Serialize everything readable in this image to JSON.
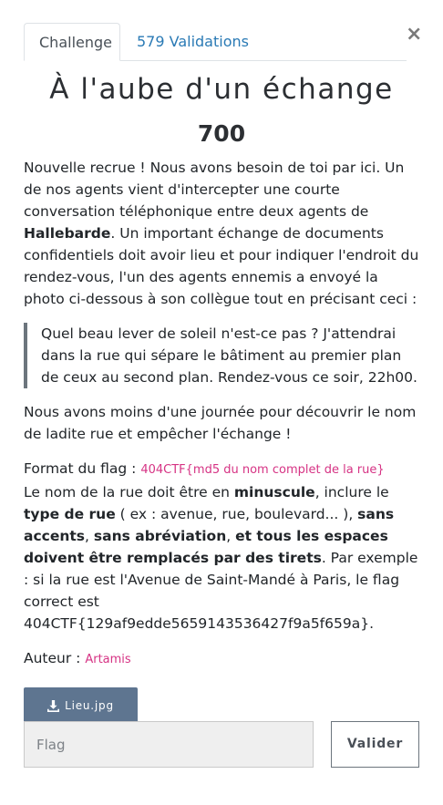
{
  "tabs": {
    "challenge": "Challenge",
    "validations": "579 Validations"
  },
  "close_glyph": "×",
  "challenge": {
    "title": "À l'aube d'un échange",
    "points": "700",
    "intro_1": "Nouvelle recrue ! Nous avons besoin de toi par ici. Un de nos agents vient d'intercepter une courte conversation téléphonique entre deux agents de ",
    "intro_bold": "Hallebarde",
    "intro_2": ". Un important échange de documents confidentiels doit avoir lieu et pour indiquer l'endroit du rendez-vous, l'un des agents ennemis a envoyé la photo ci-dessous à son collègue tout en précisant ceci :",
    "quote": "Quel beau lever de soleil n'est-ce pas ? J'attendrai dans la rue qui sépare le bâtiment au premier plan de ceux au second plan. Rendez-vous ce soir, 22h00.",
    "goal": "Nous avons moins d'une journée pour découvrir le nom de ladite rue et empêcher l'échange !",
    "format_label": "Format du flag : ",
    "format_value": "404CTF{md5 du nom complet de la rue}",
    "rule_1": "Le nom de la rue doit être en ",
    "rule_minuscule": "minuscule",
    "rule_2": ", inclure le ",
    "rule_type": "type de rue",
    "rule_3": " ( ex : avenue, rue, boulevard... ), ",
    "rule_accents": "sans accents",
    "rule_4": ", ",
    "rule_abbr": "sans abréviation",
    "rule_5": ", ",
    "rule_spaces": "et tous les espaces doivent être remplacés par des tirets",
    "rule_6": ". Par exemple : si la rue est l'Avenue de Saint-Mandé à Paris, le flag correct est 404CTF{129af9edde5659143536427f9a5f659a}.",
    "author_label": "Auteur : ",
    "author": "Artamis",
    "file_label": "Lieu.jpg"
  },
  "form": {
    "flag_placeholder": "Flag",
    "submit_label": "Valider"
  },
  "colors": {
    "link": "#2a7ab5",
    "pink": "#d63384",
    "file_button": "#5e7590"
  },
  "icons": {
    "download": "download-icon",
    "close": "close-icon"
  }
}
